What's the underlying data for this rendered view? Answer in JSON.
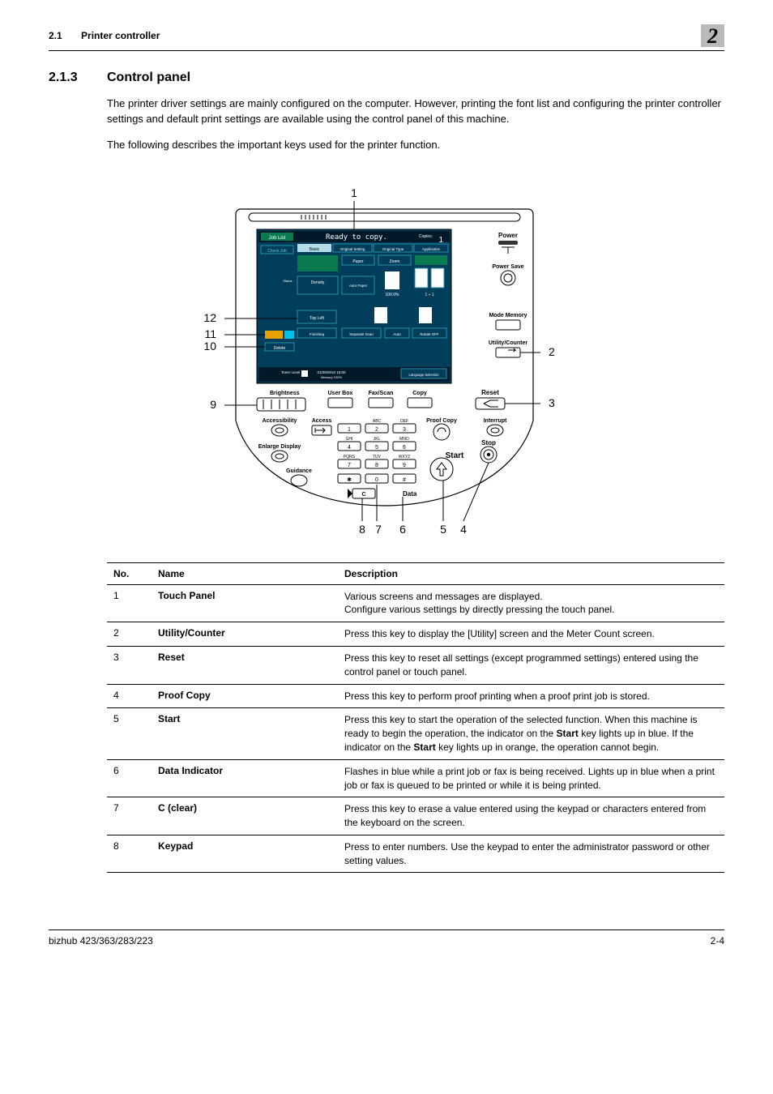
{
  "header": {
    "section_ref": "2.1",
    "section_name": "Printer controller",
    "chapter": "2"
  },
  "section": {
    "number": "2.1.3",
    "title": "Control panel",
    "para1": "The printer driver settings are mainly configured on the computer. However, printing the font list and configuring the printer controller settings and default print settings are available using the control panel of this machine.",
    "para2": "The following describes the important keys used for the printer function."
  },
  "figure": {
    "callouts": [
      "1",
      "2",
      "3",
      "4",
      "5",
      "6",
      "7",
      "8",
      "9",
      "10",
      "11",
      "12"
    ],
    "screen_text": {
      "ready": "Ready to copy.",
      "job_list": "Job List",
      "check_job": "Check Job",
      "tabs": [
        "Basic",
        "Original Setting",
        "Original Type",
        "Application"
      ],
      "mid": [
        "Density",
        "Paper",
        "Auto Paper",
        "Zoom"
      ],
      "copies": "Copies:",
      "one": "1",
      "toner": "Toner Level",
      "lang": "Language Selection",
      "rotate": "Rotate OFF",
      "separate": "Separate Scan",
      "auto": "Auto",
      "delete": "Delete",
      "status": "Status",
      "top_left": "Top Left",
      "finishing": "Finishing",
      "date": "01/09/2010 15:00",
      "memory": "Memory 100%",
      "pct": "100.0%",
      "one_one": "1 ÷ 1"
    },
    "panel_labels": {
      "power": "Power",
      "power_save": "Power Save",
      "mode_memory": "Mode Memory",
      "utility": "Utility/Counter",
      "reset": "Reset",
      "interrupt": "Interrupt",
      "stop": "Stop",
      "start": "Start",
      "proof": "Proof Copy",
      "data": "Data",
      "brightness": "Brightness",
      "user_box": "User Box",
      "fax_scan": "Fax/Scan",
      "copy": "Copy",
      "accessibility": "Accessibility",
      "access": "Access",
      "enlarge": "Enlarge Display",
      "guidance": "Guidance",
      "abc": "ABC",
      "def": "DEF",
      "ghi": "GHI",
      "jkl": "JKL",
      "mno": "MNO",
      "pqrs": "PQRS",
      "tuv": "TUV",
      "wxyz": "WXYZ"
    }
  },
  "table": {
    "headers": {
      "no": "No.",
      "name": "Name",
      "desc": "Description"
    },
    "rows": [
      {
        "no": "1",
        "name": "Touch Panel",
        "desc": "Various screens and messages are displayed.\nConfigure various settings by directly pressing the touch panel."
      },
      {
        "no": "2",
        "name": "Utility/Counter",
        "desc": "Press this key to display the [Utility] screen and the Meter Count screen."
      },
      {
        "no": "3",
        "name": "Reset",
        "desc": "Press this key to reset all settings (except programmed settings) entered using the control panel or touch panel."
      },
      {
        "no": "4",
        "name": "Proof Copy",
        "desc": "Press this key to perform proof printing when a proof print job is stored."
      },
      {
        "no": "5",
        "name": "Start",
        "desc_html": "Press this key to start the operation of the selected function. When this machine is ready to begin the operation, the indicator on the <b>Start</b> key lights up in blue. If the indicator on the <b>Start</b> key lights up in orange, the operation cannot begin."
      },
      {
        "no": "6",
        "name": "Data Indicator",
        "desc": "Flashes in blue while a print job or fax is being received. Lights up in blue when a print job or fax is queued to be printed or while it is being printed."
      },
      {
        "no": "7",
        "name_html": "<b>C</b> (clear)",
        "desc": "Press this key to erase a value entered using the keypad or characters entered from the keyboard on the screen."
      },
      {
        "no": "8",
        "name": "Keypad",
        "desc": "Press to enter numbers. Use the keypad to enter the administrator password or other setting values."
      }
    ]
  },
  "footer": {
    "left": "bizhub 423/363/283/223",
    "right": "2-4"
  }
}
